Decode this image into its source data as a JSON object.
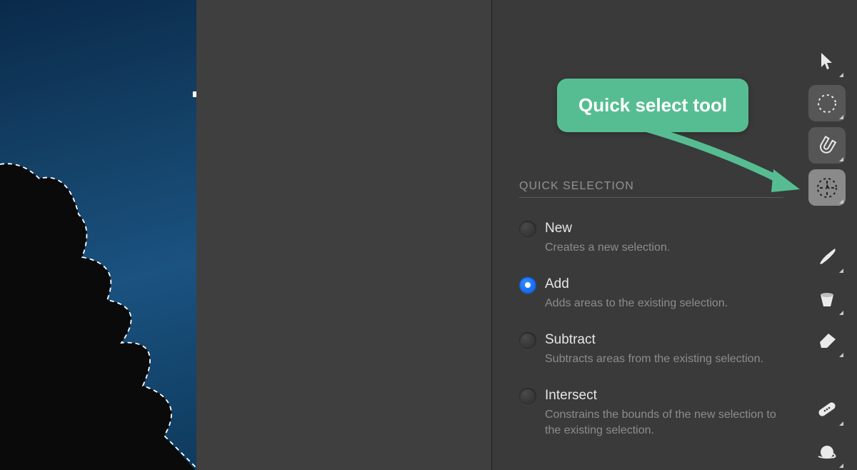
{
  "callout": {
    "text": "Quick select tool"
  },
  "panel": {
    "header": "QUICK SELECTION",
    "options": [
      {
        "id": "new",
        "title": "New",
        "desc": "Creates a new selection.",
        "selected": false
      },
      {
        "id": "add",
        "title": "Add",
        "desc": "Adds areas to the existing selection.",
        "selected": true
      },
      {
        "id": "subtract",
        "title": "Subtract",
        "desc": "Subtracts areas from the existing selection.",
        "selected": false
      },
      {
        "id": "intersect",
        "title": "Intersect",
        "desc": "Constrains the bounds of the new selection to the existing selection.",
        "selected": false
      }
    ]
  },
  "tools": [
    {
      "icon": "arrow-cursor",
      "state": "plain"
    },
    {
      "icon": "marquee-ellipse",
      "state": "soft"
    },
    {
      "icon": "magnet",
      "state": "soft"
    },
    {
      "icon": "quick-select",
      "state": "active"
    },
    {
      "gap": true
    },
    {
      "icon": "brush",
      "state": "plain"
    },
    {
      "icon": "bucket",
      "state": "plain"
    },
    {
      "icon": "eraser",
      "state": "plain"
    },
    {
      "gap": true
    },
    {
      "icon": "bandage",
      "state": "plain"
    },
    {
      "icon": "sphere-rotate",
      "state": "plain"
    }
  ]
}
